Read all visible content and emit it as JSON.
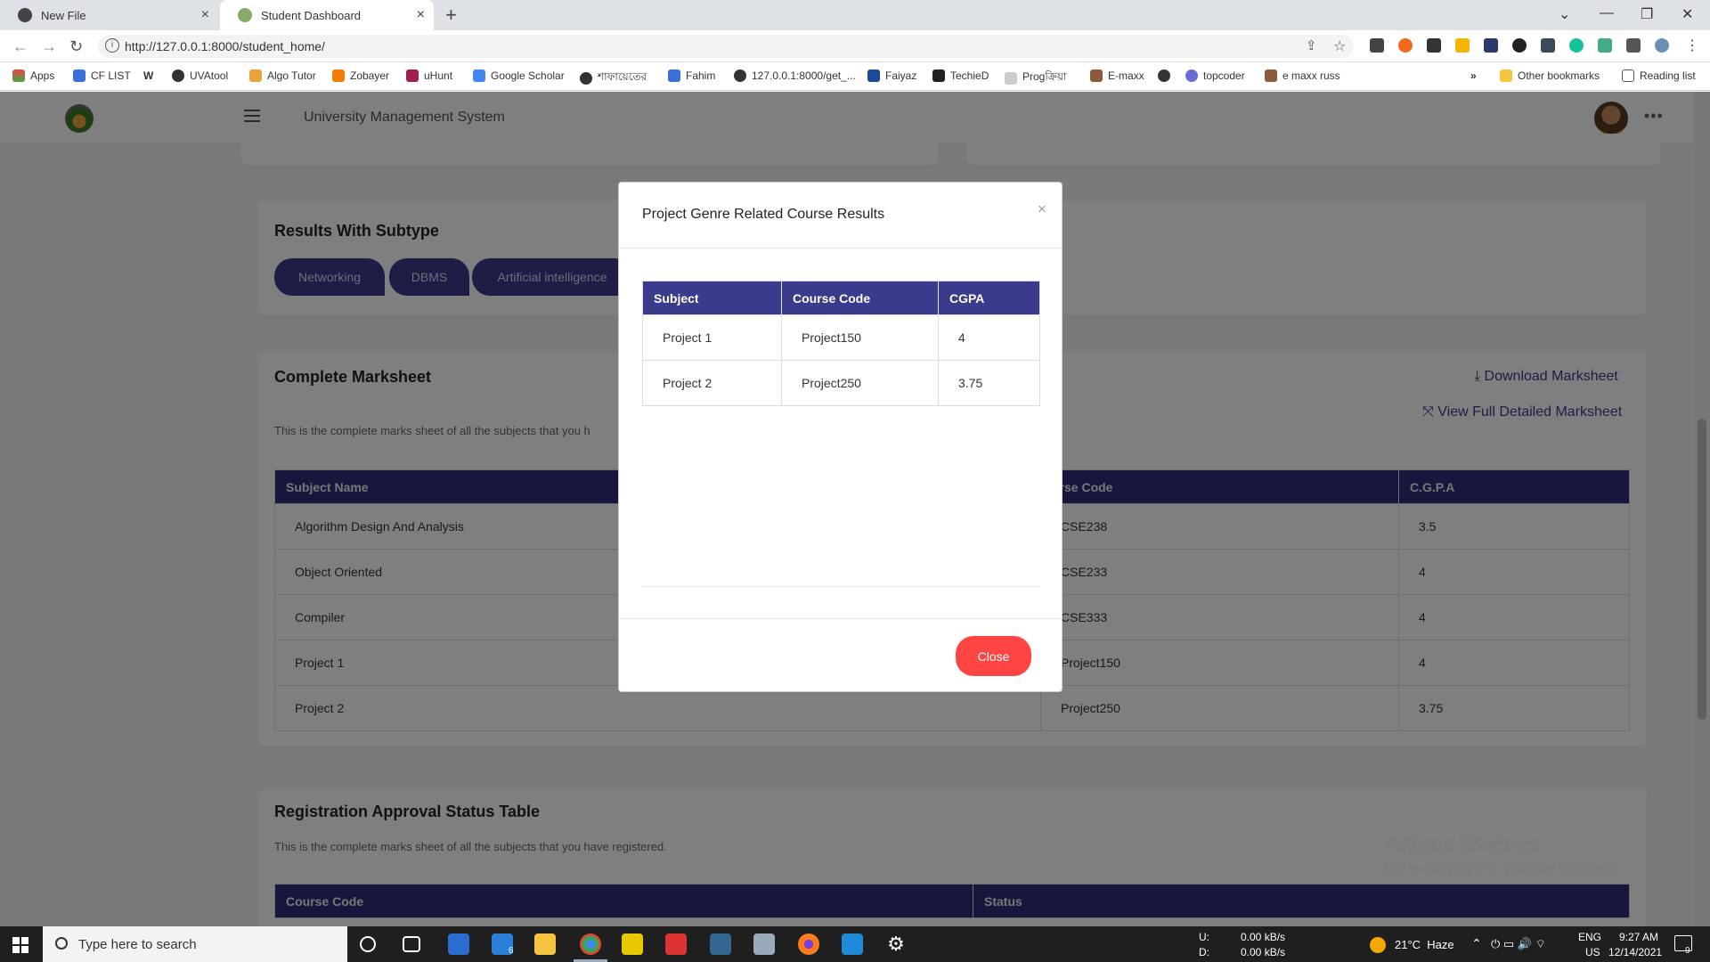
{
  "browser": {
    "tabs": [
      {
        "title": "New File"
      },
      {
        "title": "Student Dashboard"
      }
    ],
    "url": "http://127.0.0.1:8000/student_home/",
    "bookmarks": [
      "Apps",
      "CF LIST",
      "W",
      "UVAtool",
      "Algo Tutor",
      "Zobayer",
      "uHunt",
      "Google Scholar",
      "শাফায়েতের",
      "Fahim",
      "127.0.0.1:8000/get_...",
      "Faiyaz",
      "TechieD",
      "Progক্রিয়া",
      "E-maxx",
      "topcoder",
      "e maxx russ"
    ],
    "bookmarks_more": "»",
    "other_bookmarks": "Other bookmarks",
    "reading_list": "Reading list"
  },
  "app": {
    "title": "University Management System"
  },
  "results_subtype": {
    "heading": "Results With Subtype",
    "buttons": [
      "Networking",
      "DBMS",
      "Artificial intelligence"
    ]
  },
  "marksheet": {
    "heading": "Complete Marksheet",
    "description": "This is the complete marks sheet of all the subjects that you h",
    "download_link": "Download Marksheet",
    "view_link": "View Full Detailed Marksheet",
    "columns": [
      "Subject Name",
      "urse Code",
      "C.G.P.A"
    ],
    "rows": [
      [
        "Algorithm Design And Analysis",
        "CSE238",
        "3.5"
      ],
      [
        "Object Oriented",
        "CSE233",
        "4"
      ],
      [
        "Compiler",
        "CSE333",
        "4"
      ],
      [
        "Project 1",
        "Project150",
        "4"
      ],
      [
        "Project 2",
        "Project250",
        "3.75"
      ]
    ]
  },
  "registration": {
    "heading": "Registration Approval Status Table",
    "description": "This is the complete marks sheet of all the subjects that you have registered.",
    "columns": [
      "Course Code",
      "Status"
    ]
  },
  "modal": {
    "title": "Project Genre Related Course Results",
    "close_x": "×",
    "columns": [
      "Subject",
      "Course Code",
      "CGPA"
    ],
    "rows": [
      [
        "Project 1",
        "Project150",
        "4"
      ],
      [
        "Project 2",
        "Project250",
        "3.75"
      ]
    ],
    "close_button": "Close"
  },
  "watermark": {
    "line1": "Activate Windows",
    "line2": "Go to Settings to activate Windows."
  },
  "taskbar": {
    "search_placeholder": "Type here to search",
    "net_up": "0.00 kB/s",
    "net_down": "0.00 kB/s",
    "net_up_label": "U:",
    "net_down_label": "D:",
    "weather": "21°C  Haze",
    "lang": "ENG",
    "region": "US",
    "time": "9:27 AM",
    "date": "12/14/2021",
    "notification_count": "9",
    "mail_badge": "6"
  }
}
